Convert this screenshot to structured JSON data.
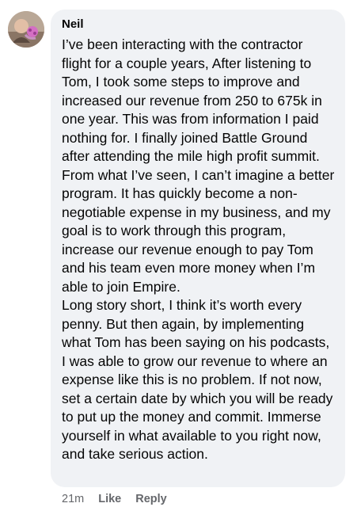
{
  "comment": {
    "author": "Neil",
    "paragraphs": [
      "I’ve been interacting with the contractor flight for a couple years, After listening to Tom, I took some steps to improve and increased our revenue from 250 to 675k in one year. This was from information I paid nothing for. I finally joined Battle Ground after attending the mile high profit summit. From what I’ve seen, I can’t imagine a better program. It has quickly become a non-negotiable expense in my business, and my goal is to work through this program, increase our revenue enough to pay Tom and his team even more money when I’m able to join Empire.",
      "Long story short, I think it’s worth every penny. But then again, by implementing what Tom has been saying on his podcasts, I was able to grow our revenue to where an expense like this is no problem. If not now, set a certain date by which you will be ready to put up the money and commit. Immerse yourself in what available to you right now, and take serious action."
    ]
  },
  "meta": {
    "timestamp": "21m",
    "like_label": "Like",
    "reply_label": "Reply"
  },
  "colors": {
    "bubble_bg": "#f0f2f5",
    "text": "#050505",
    "secondary_text": "#65676b"
  }
}
